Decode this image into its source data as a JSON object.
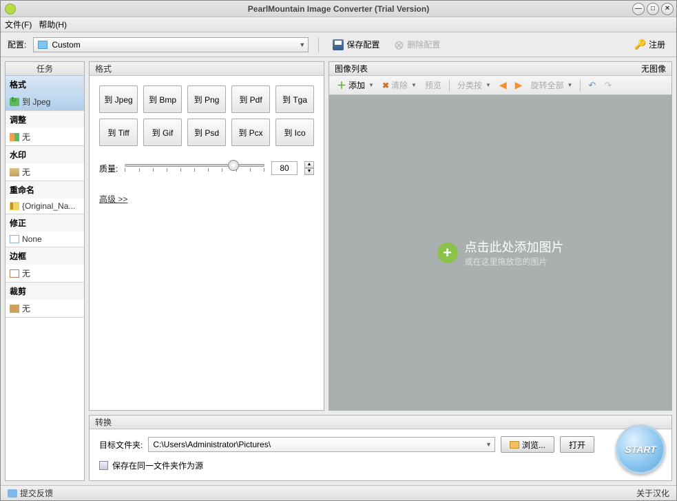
{
  "title": "PearlMountain Image Converter (Trial Version)",
  "menu": {
    "file": "文件(F)",
    "help": "帮助(H)"
  },
  "toolbar": {
    "config_label": "配置:",
    "config_value": "Custom",
    "save_config": "保存配置",
    "delete_config": "删除配置",
    "register": "注册"
  },
  "tasks": {
    "header": "任务",
    "groups": [
      {
        "title": "格式",
        "value": "到 Jpeg",
        "icon": "convert",
        "selected": true
      },
      {
        "title": "调整",
        "value": "无",
        "icon": "adjust"
      },
      {
        "title": "水印",
        "value": "无",
        "icon": "water"
      },
      {
        "title": "重命名",
        "value": "{Original_Na...",
        "icon": "rename"
      },
      {
        "title": "修正",
        "value": "None",
        "icon": "fix"
      },
      {
        "title": "边框",
        "value": "无",
        "icon": "border"
      },
      {
        "title": "裁剪",
        "value": "无",
        "icon": "crop"
      }
    ]
  },
  "format": {
    "header": "格式",
    "buttons": [
      "到 Jpeg",
      "到 Bmp",
      "到 Png",
      "到 Pdf",
      "到 Tga",
      "到 Tiff",
      "到 Gif",
      "到 Psd",
      "到 Pcx",
      "到 Ico"
    ],
    "quality_label": "质量:",
    "quality_value": "80",
    "advanced": "高级 >>"
  },
  "imagelist": {
    "header": "图像列表",
    "no_image": "无图像",
    "add": "添加",
    "clear": "清除",
    "preview": "预览",
    "sort_by": "分类按",
    "rotate_all": "旋转全部",
    "drop_main": "点击此处添加图片",
    "drop_sub": "或在这里拖放您的图片"
  },
  "convert": {
    "header": "转换",
    "dest_label": "目标文件夹:",
    "dest_value": "C:\\Users\\Administrator\\Pictures\\",
    "browse": "浏览...",
    "open": "打开",
    "save_same": "保存在同一文件夹作为源",
    "start": "START"
  },
  "status": {
    "feedback": "提交反馈",
    "about": "关于汉化"
  }
}
